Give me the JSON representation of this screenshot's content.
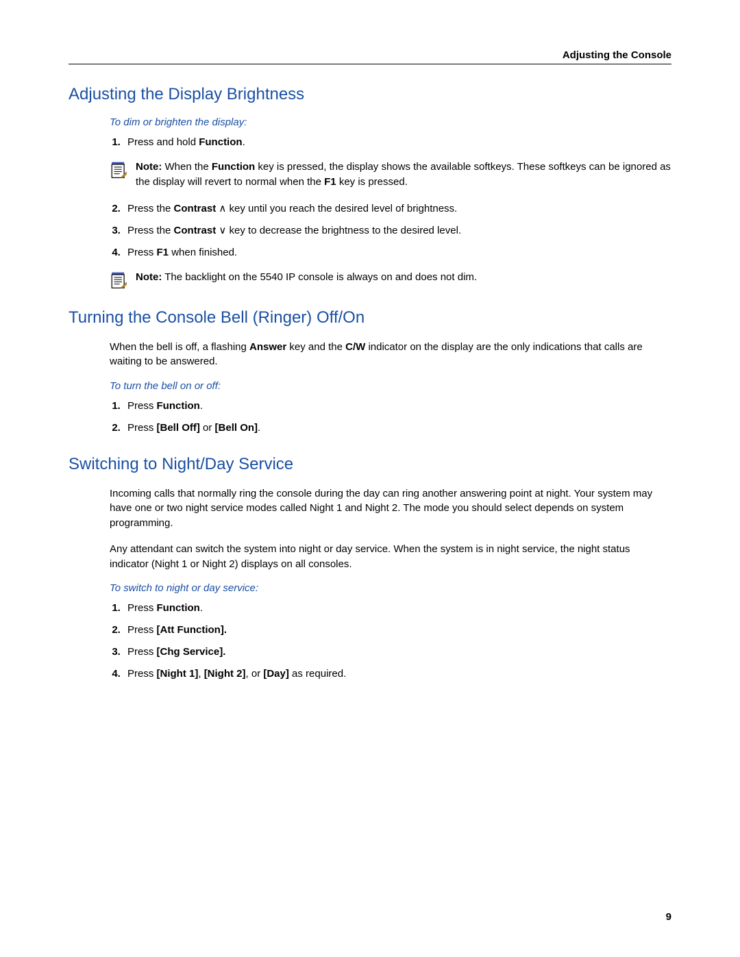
{
  "header": {
    "right": "Adjusting the Console"
  },
  "page_number": "9",
  "sections": [
    {
      "title": "Adjusting the Display Brightness",
      "subhead": "To dim or brighten the display:",
      "step1": {
        "pre": "Press and hold ",
        "b1": "Function",
        "post": "."
      },
      "note1": {
        "label": "Note:",
        "t1": " When the ",
        "b1": "Function",
        "t2": " key is pressed, the display shows the available softkeys. These softkeys can be ignored as the display will revert to normal when the ",
        "b2": "F1",
        "t3": " key is pressed."
      },
      "step2": {
        "pre": "Press the ",
        "b1": "Contrast",
        "sym": " ∧ ",
        "post": "key until you reach the desired level of brightness."
      },
      "step3": {
        "pre": "Press the ",
        "b1": "Contrast",
        "sym": " ∨ ",
        "post": "key to decrease the brightness to the desired level."
      },
      "step4": {
        "pre": "Press ",
        "b1": "F1",
        "post": " when finished."
      },
      "note2": {
        "label": "Note:",
        "t1": " The backlight on the 5540 IP console is always on and does not dim."
      }
    },
    {
      "title": "Turning the Console Bell (Ringer) Off/On",
      "intro": {
        "t1": "When the bell is off, a flashing ",
        "b1": "Answer",
        "t2": " key and the ",
        "b2": "C/W",
        "t3": " indicator on the display are the only indications that calls are waiting to be answered."
      },
      "subhead": "To turn the bell on or off:",
      "step1": {
        "pre": "Press ",
        "b1": "Function",
        "post": "."
      },
      "step2": {
        "pre": "Press ",
        "b1": "[Bell Off]",
        "mid": " or ",
        "b2": "[Bell On]",
        "post": "."
      }
    },
    {
      "title": "Switching to Night/Day Service",
      "p1": "Incoming calls that normally ring the console during the day can ring another answering point at night. Your system may have one or two night service modes called Night 1 and Night 2. The mode you should select depends on system programming.",
      "p2": "Any attendant can switch the system into night or day service. When the system is in night service, the night status indicator (Night 1 or Night 2) displays on all consoles.",
      "subhead": "To switch to night or day service:",
      "step1": {
        "pre": "Press ",
        "b1": "Function",
        "post": "."
      },
      "step2": {
        "pre": "Press ",
        "b1": "[Att Function].",
        "post": ""
      },
      "step3": {
        "pre": "Press ",
        "b1": "[Chg Service].",
        "post": ""
      },
      "step4": {
        "pre": "Press ",
        "b1": "[Night 1]",
        "mid1": ", ",
        "b2": "[Night 2]",
        "mid2": ", or ",
        "b3": "[Day]",
        "post": " as required."
      }
    }
  ]
}
